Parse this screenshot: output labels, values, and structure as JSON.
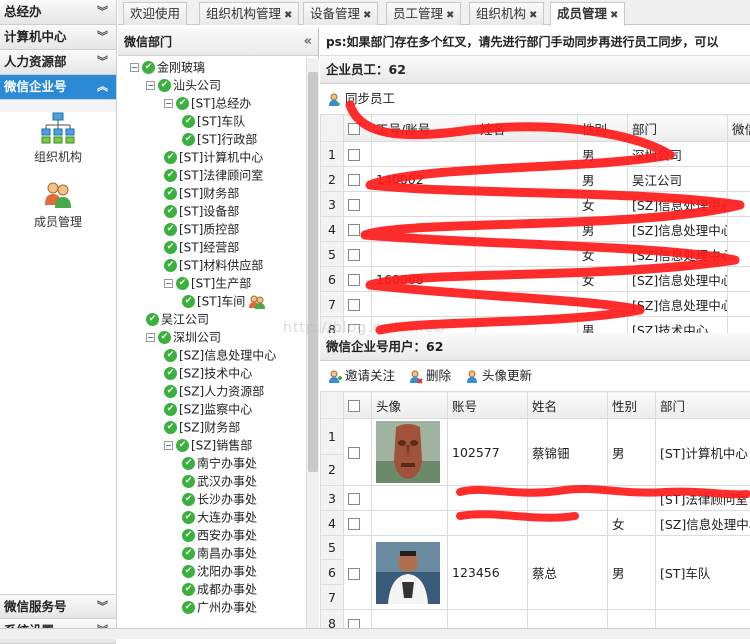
{
  "nav": {
    "sections": [
      {
        "label": "总经办",
        "expanded": false
      },
      {
        "label": "计算机中心",
        "expanded": false
      },
      {
        "label": "人力资源部",
        "expanded": false
      },
      {
        "label": "微信企业号",
        "expanded": true
      },
      {
        "label": "微信服务号",
        "expanded": false
      },
      {
        "label": "系统设置",
        "expanded": false
      }
    ],
    "items": [
      {
        "label": "组织机构",
        "icon": "org-chart-icon"
      },
      {
        "label": "成员管理",
        "icon": "members-icon"
      }
    ]
  },
  "tabs": [
    {
      "label": "欢迎使用",
      "closable": false,
      "active": false
    },
    {
      "label": "组织机构管理",
      "closable": true,
      "active": false
    },
    {
      "label": "设备管理",
      "closable": true,
      "active": false
    },
    {
      "label": "员工管理",
      "closable": true,
      "active": false
    },
    {
      "label": "组织机构",
      "closable": true,
      "active": false
    },
    {
      "label": "成员管理",
      "closable": true,
      "active": true
    }
  ],
  "dept_panel": {
    "title": "微信部门",
    "tree": [
      {
        "label": "金刚玻璃",
        "level": 0,
        "toggle": "−"
      },
      {
        "label": "汕头公司",
        "level": 1,
        "toggle": "−"
      },
      {
        "label": "[ST]总经办",
        "level": 2,
        "toggle": "−"
      },
      {
        "label": "[ST]车队",
        "level": 3
      },
      {
        "label": "[ST]行政部",
        "level": 3
      },
      {
        "label": "[ST]计算机中心",
        "level": 2
      },
      {
        "label": "[ST]法律顾问室",
        "level": 2
      },
      {
        "label": "[ST]财务部",
        "level": 2
      },
      {
        "label": "[ST]设备部",
        "level": 2
      },
      {
        "label": "[ST]质控部",
        "level": 2
      },
      {
        "label": "[ST]经营部",
        "level": 2
      },
      {
        "label": "[ST]材料供应部",
        "level": 2
      },
      {
        "label": "[ST]生产部",
        "level": 2,
        "toggle": "−"
      },
      {
        "label": "[ST]车间",
        "level": 3,
        "user_icon": true
      },
      {
        "label": "吴江公司",
        "level": 1
      },
      {
        "label": "深圳公司",
        "level": 1,
        "toggle": "−"
      },
      {
        "label": "[SZ]信息处理中心",
        "level": 2
      },
      {
        "label": "[SZ]技术中心",
        "level": 2
      },
      {
        "label": "[SZ]人力资源部",
        "level": 2
      },
      {
        "label": "[SZ]监察中心",
        "level": 2
      },
      {
        "label": "[SZ]财务部",
        "level": 2
      },
      {
        "label": "[SZ]销售部",
        "level": 2,
        "toggle": "−"
      },
      {
        "label": "南宁办事处",
        "level": 3
      },
      {
        "label": "武汉办事处",
        "level": 3
      },
      {
        "label": "长沙办事处",
        "level": 3
      },
      {
        "label": "大连办事处",
        "level": 3
      },
      {
        "label": "西安办事处",
        "level": 3
      },
      {
        "label": "南昌办事处",
        "level": 3
      },
      {
        "label": "沈阳办事处",
        "level": 3
      },
      {
        "label": "成都办事处",
        "level": 3
      },
      {
        "label": "广州办事处",
        "level": 3
      }
    ]
  },
  "notice": "ps:如果部门存在多个红叉，请先进行部门手动同步再进行员工同步，可以",
  "employees": {
    "title": "企业员工：62",
    "sync_label": "同步员工",
    "columns": [
      "工号/账号",
      "姓名",
      "性别",
      "部门",
      "微信"
    ],
    "rows": [
      {
        "n": "1",
        "id": "",
        "name": "",
        "sex": "男",
        "dept": "深圳公司"
      },
      {
        "n": "2",
        "id": "140002",
        "name": "",
        "sex": "男",
        "dept": "吴江公司"
      },
      {
        "n": "3",
        "id": "",
        "name": "",
        "sex": "女",
        "dept": "[SZ]信息处理中心"
      },
      {
        "n": "4",
        "id": "",
        "name": "",
        "sex": "男",
        "dept": "[SZ]信息处理中心"
      },
      {
        "n": "5",
        "id": "",
        "name": "",
        "sex": "女",
        "dept": "[SZ]信息处理中心"
      },
      {
        "n": "6",
        "id": "160068",
        "name": "",
        "sex": "女",
        "dept": "[SZ]信息处理中心"
      },
      {
        "n": "7",
        "id": "",
        "name": "",
        "sex": "",
        "dept": "[SZ]信息处理中心"
      },
      {
        "n": "8",
        "id": "",
        "name": "",
        "sex": "男",
        "dept": "[SZ]技术中心"
      }
    ]
  },
  "wx_users": {
    "title": "微信企业号用户：62",
    "actions": [
      {
        "label": "邀请关注",
        "icon": "invite-icon"
      },
      {
        "label": "删除",
        "icon": "delete-user-icon"
      },
      {
        "label": "头像更新",
        "icon": "avatar-update-icon"
      }
    ],
    "columns": [
      "头像",
      "账号",
      "姓名",
      "性别",
      "部门"
    ],
    "rows": [
      {
        "n": [
          "1",
          "2"
        ],
        "id": "102577",
        "name": "蔡锦钿",
        "sex": "男",
        "dept": "[ST]计算机中心",
        "avatar": "carving"
      },
      {
        "n": [
          "3"
        ],
        "id": "",
        "name": "",
        "sex": "",
        "dept": "[ST]法律顾问室"
      },
      {
        "n": [
          "4"
        ],
        "id": "",
        "name": "",
        "sex": "女",
        "dept": "[SZ]信息处理中心"
      },
      {
        "n": [
          "5",
          "6",
          "7"
        ],
        "id": "123456",
        "name": "蔡总",
        "sex": "男",
        "dept": "[ST]车队",
        "avatar": "man"
      },
      {
        "n": [
          "8"
        ],
        "id": "",
        "name": "",
        "sex": "",
        "dept": ""
      }
    ]
  },
  "watermark": "http://blog.csdn.net/"
}
